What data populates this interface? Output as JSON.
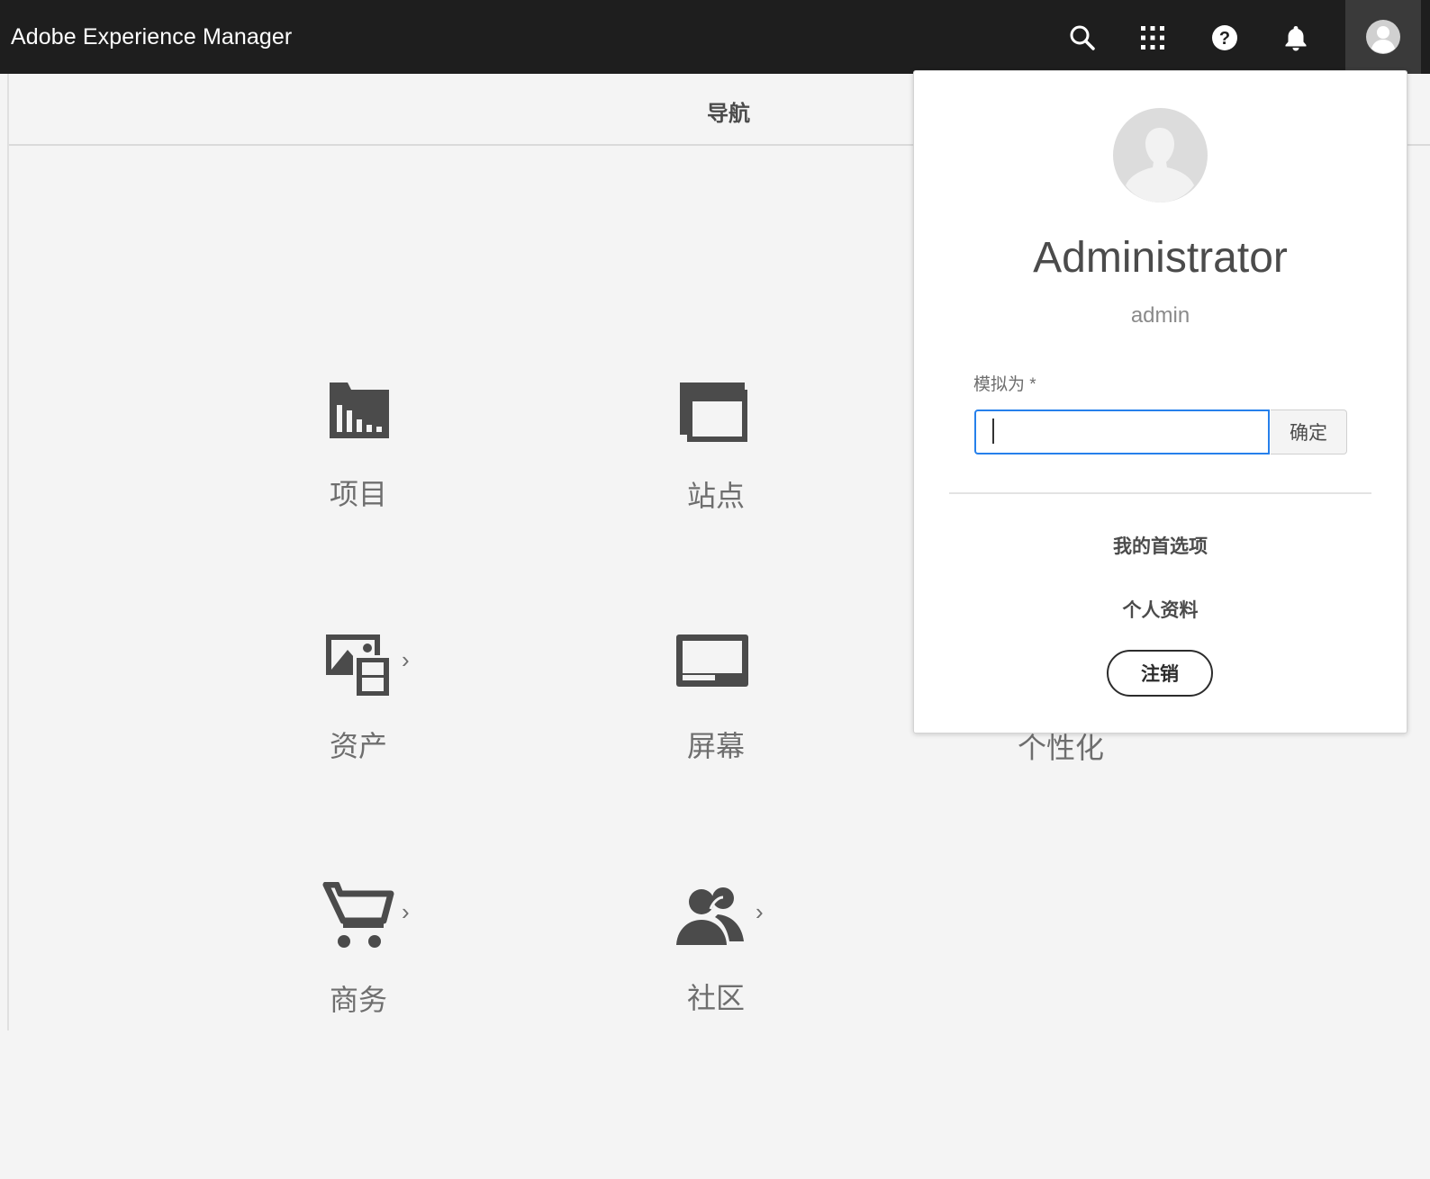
{
  "header": {
    "brand": "Adobe Experience Manager",
    "icons": [
      "search-icon",
      "apps-grid-icon",
      "help-icon",
      "bell-icon",
      "user-avatar-icon"
    ]
  },
  "nav": {
    "title": "导航",
    "tiles": [
      {
        "label": "项目",
        "icon": "projects-icon",
        "has_submenu": false
      },
      {
        "label": "站点",
        "icon": "sites-icon",
        "has_submenu": false
      },
      {
        "label": "资产",
        "icon": "assets-icon",
        "has_submenu": true
      },
      {
        "label": "屏幕",
        "icon": "screens-icon",
        "has_submenu": false
      },
      {
        "label": "个性化",
        "icon": "personalization-icon",
        "has_submenu": false
      },
      {
        "label": "商务",
        "icon": "commerce-cart-icon",
        "has_submenu": true
      },
      {
        "label": "社区",
        "icon": "communities-icon",
        "has_submenu": true
      }
    ],
    "chevron": "›"
  },
  "user_popover": {
    "display_name": "Administrator",
    "user_id": "admin",
    "impersonate_label": "模拟为 *",
    "impersonate_value": "",
    "ok_label": "确定",
    "preferences_label": "我的首选项",
    "profile_label": "个人资料",
    "signout_label": "注销"
  },
  "colors": {
    "topbar": "#1e1e1e",
    "background": "#f4f4f4",
    "focus_blue": "#2680eb",
    "icon_dark": "#4b4b4b"
  }
}
